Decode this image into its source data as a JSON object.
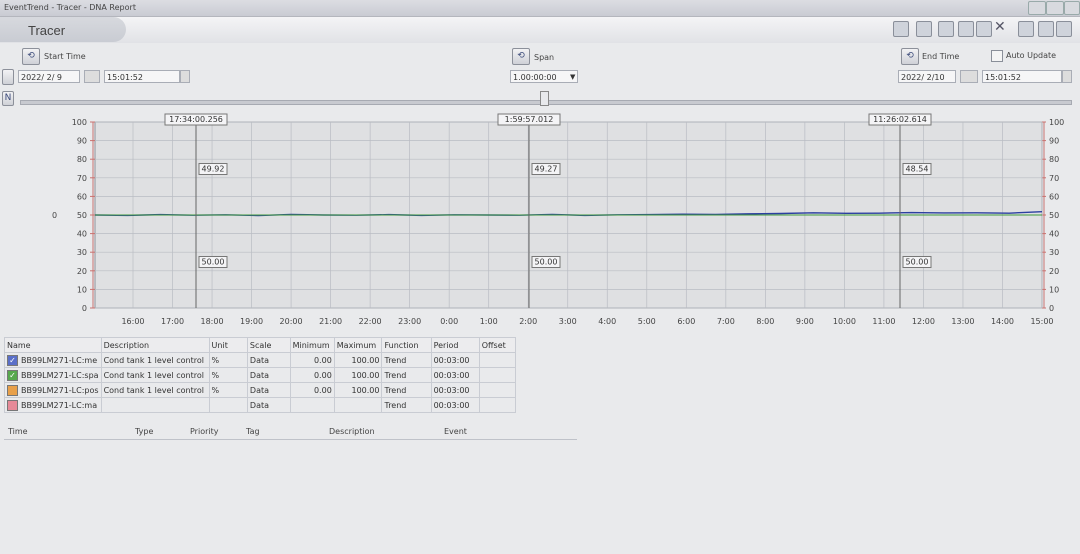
{
  "window": {
    "title": "EventTrend - Tracer - DNA Report"
  },
  "header": {
    "tab_label": "Tracer"
  },
  "controls": {
    "start_label": "Start Time",
    "start_date": "2022/ 2/ 9",
    "start_time": "15:01:52",
    "span_label": "Span",
    "span_value": "1.00:00:00",
    "end_label": "End Time",
    "end_date": "2022/ 2/10",
    "end_time": "15:01:52",
    "auto_update_label": "Auto Update"
  },
  "chart_data": {
    "type": "line",
    "ylim": [
      0,
      100
    ],
    "y_ticks": [
      "100",
      "90",
      "80",
      "70",
      "60",
      "50",
      "40",
      "30",
      "20",
      "10",
      "0"
    ],
    "right_ticks": [
      "100",
      "90",
      "80",
      "70",
      "60",
      "50",
      "40",
      "30",
      "20",
      "10",
      "0"
    ],
    "left_zero": "0",
    "x_ticks": [
      "16:00",
      "17:00",
      "18:00",
      "19:00",
      "20:00",
      "21:00",
      "22:00",
      "23:00",
      "0:00",
      "1:00",
      "2:00",
      "3:00",
      "4:00",
      "5:00",
      "6:00",
      "7:00",
      "8:00",
      "9:00",
      "10:00",
      "11:00",
      "12:00",
      "13:00",
      "14:00",
      "15:00"
    ],
    "cursors": [
      {
        "time": "17:34:00.256",
        "value_upper": "49.92",
        "value_lower": "50.00"
      },
      {
        "time": "1:59:57.012",
        "value_upper": "49.27",
        "value_lower": "50.00"
      },
      {
        "time": "11:26:02.614",
        "value_upper": "48.54",
        "value_lower": "50.00"
      }
    ],
    "series": [
      {
        "color": "#2c3fa0",
        "values": [
          50.0,
          49.8,
          50.2,
          49.9,
          50.1,
          49.7,
          50.3,
          50.0,
          49.9,
          50.2,
          49.8,
          50.1,
          50.0,
          49.9,
          50.3,
          49.8,
          50.1,
          50.2,
          50.4,
          50.3,
          50.6,
          50.8,
          51.2,
          50.9,
          51.0,
          51.3,
          51.1,
          51.2,
          51.0,
          51.8
        ]
      },
      {
        "color": "#3f9a3a",
        "values": [
          50,
          50,
          50,
          50,
          50,
          50,
          50,
          50,
          50,
          50,
          50,
          50,
          50,
          50,
          50,
          50,
          50,
          50,
          50,
          50,
          50,
          50,
          50,
          50,
          50,
          50,
          50,
          50,
          50,
          50
        ]
      }
    ]
  },
  "table": {
    "headers": [
      "Name",
      "Description",
      "Unit",
      "Scale",
      "Minimum",
      "Maximum",
      "Function",
      "Period",
      "Offset"
    ],
    "rows": [
      {
        "name": "BB99LM271-LC:me",
        "desc": "Cond tank 1 level control",
        "unit": "%",
        "scale": "Data",
        "min": "0.00",
        "max": "100.00",
        "func": "Trend",
        "period": "00:03:00",
        "offset": "",
        "color": "#5a6fc8",
        "checked": true
      },
      {
        "name": "BB99LM271-LC:spa",
        "desc": "Cond tank 1 level control",
        "unit": "%",
        "scale": "Data",
        "min": "0.00",
        "max": "100.00",
        "func": "Trend",
        "period": "00:03:00",
        "offset": "",
        "color": "#58a84d",
        "checked": true
      },
      {
        "name": "BB99LM271-LC:pos",
        "desc": "Cond tank 1 level control",
        "unit": "%",
        "scale": "Data",
        "min": "0.00",
        "max": "100.00",
        "func": "Trend",
        "period": "00:03:00",
        "offset": "",
        "color": "#e8a04a",
        "checked": false
      },
      {
        "name": "BB99LM271-LC:ma",
        "desc": "",
        "unit": "",
        "scale": "Data",
        "min": "",
        "max": "",
        "func": "Trend",
        "period": "00:03:00",
        "offset": "",
        "color": "#e68a98",
        "checked": false
      }
    ]
  },
  "events": {
    "headers": [
      "Time",
      "Type",
      "Priority",
      "Tag",
      "Description",
      "Event"
    ]
  }
}
